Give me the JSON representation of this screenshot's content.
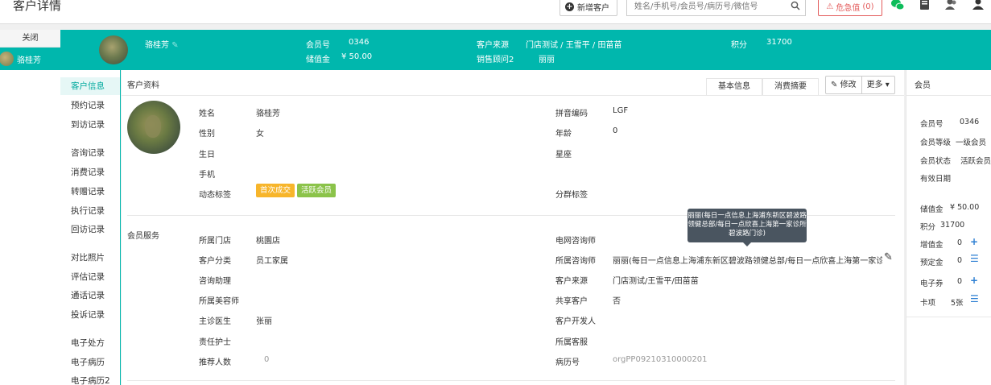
{
  "header_bar": {
    "page_title": "客户详情",
    "new_customer_label": "新增客户",
    "search_placeholder": "姓名/手机号/会员号/病历号/微信号",
    "danger_label": "危急值",
    "danger_count": "0"
  },
  "left_tabs": {
    "close_label": "关闭",
    "customer_tab_label": "骆桂芳"
  },
  "customer_header": {
    "name": "骆桂芳",
    "member_no_label": "会员号",
    "member_no": "0346",
    "stored_label": "储值金",
    "stored_value": "¥ 50.00",
    "source_label": "客户来源",
    "source_value": "门店测试 / 王雪平 / 田苗苗",
    "consultant_label": "销售顾问2",
    "consultant_value": "丽丽",
    "points_label": "积分",
    "points_value": "31700"
  },
  "subnav": [
    "客户信息",
    "预约记录",
    "到访记录",
    "咨询记录",
    "消费记录",
    "转赠记录",
    "执行记录",
    "回访记录",
    "对比照片",
    "评估记录",
    "通话记录",
    "投诉记录",
    "电子处方",
    "电子病历",
    "电子病历2"
  ],
  "main": {
    "section_title": "客户资料",
    "tabs": [
      "基本信息",
      "消费摘要"
    ],
    "edit_label": "修改",
    "more_label": "更多",
    "basic": {
      "name_label": "姓名",
      "name_value": "骆桂芳",
      "gender_label": "性别",
      "gender_value": "女",
      "birthday_label": "生日",
      "phone_label": "手机",
      "tags_label": "动态标签",
      "tags": [
        "首次成交",
        "活跃会员"
      ],
      "pinyin_label": "拼音编码",
      "pinyin_value": "LGF",
      "age_label": "年龄",
      "age_value": "0",
      "zodiac_label": "星座",
      "group_tag_label": "分群标签"
    },
    "service": {
      "title": "会员服务",
      "left": [
        {
          "label": "所属门店",
          "value": "桃園店"
        },
        {
          "label": "客户分类",
          "value": "员工家属"
        },
        {
          "label": "咨询助理",
          "value": ""
        },
        {
          "label": "所属美容师",
          "value": ""
        },
        {
          "label": "主诊医生",
          "value": "张丽"
        },
        {
          "label": "责任护士",
          "value": ""
        },
        {
          "label": "推荐人数",
          "value": "0"
        }
      ],
      "right": [
        {
          "label": "电网咨询师",
          "value": ""
        },
        {
          "label": "所属咨询师",
          "value": "丽丽(每日一点信息上海浦东新区碧波路领健总部/每日一点欣喜上海第一家诊..."
        },
        {
          "label": "客户来源",
          "value": "门店测试/王雪平/田苗苗"
        },
        {
          "label": "共享客户",
          "value": "否"
        },
        {
          "label": "客户开发人",
          "value": ""
        },
        {
          "label": "所属客服",
          "value": ""
        },
        {
          "label": "病历号",
          "value": "orgPP09210310000201"
        }
      ],
      "tooltip": "丽丽(每日一点信息上海浦东新区碧波路领健总部/每日一点欣喜上海第一家诊所碧波路门诊)"
    }
  },
  "right_panel": {
    "title": "会员",
    "member_no_label": "会员号",
    "member_no": "0346",
    "level_label": "会员等级",
    "level_value": "一级会员",
    "status_label": "会员状态",
    "status_value": "活跃会员",
    "expiry_label": "有效日期",
    "stored_label": "储值金",
    "stored_value": "¥ 50.00",
    "points_label": "积分",
    "points_value": "31700",
    "gift_label": "增值金",
    "gift_value": "0",
    "deposit_label": "预定金",
    "deposit_value": "0",
    "coupon_label": "电子券",
    "coupon_value": "0",
    "card_label": "卡项",
    "card_value": "5张"
  }
}
